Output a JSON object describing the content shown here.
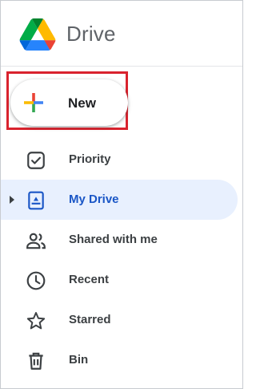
{
  "app": {
    "name": "Drive",
    "logo_icon": "google-drive-logo"
  },
  "new_button": {
    "label": "New",
    "icon": "multicolor-plus-icon",
    "highlight_color": "#d9232e"
  },
  "nav": {
    "items": [
      {
        "label": "Priority",
        "icon": "priority-check-icon",
        "active": false
      },
      {
        "label": "My Drive",
        "icon": "my-drive-icon",
        "active": true
      },
      {
        "label": "Shared with me",
        "icon": "people-icon",
        "active": false
      },
      {
        "label": "Recent",
        "icon": "clock-icon",
        "active": false
      },
      {
        "label": "Starred",
        "icon": "star-icon",
        "active": false
      },
      {
        "label": "Bin",
        "icon": "trash-icon",
        "active": false
      }
    ]
  },
  "colors": {
    "accent": "#1a56c6",
    "active_bg": "#e8f0fe",
    "icon": "#5f6368"
  }
}
